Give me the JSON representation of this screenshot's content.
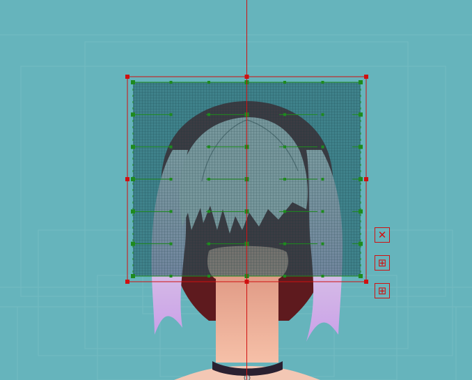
{
  "canvas": {
    "background_color": "#66b4bc",
    "guide_line_color": "#8fc8cf",
    "bounding_box_color": "#d01010",
    "deform_grid_color": "#1e8a1e",
    "grid_fill_color": "#1f5a63"
  },
  "artwork": {
    "hair_color": "#5e1a1e",
    "hair_highlight_color": "#e2e2e2",
    "hair_tip_color": "#d8b4ec",
    "skin_color": "#f0b29a",
    "choker_color": "#2a2030"
  },
  "deformer": {
    "grid_rows": 7,
    "grid_cols": 7
  },
  "toolbar": {
    "buttons": [
      {
        "name": "close-deformer-button",
        "icon": "close-icon",
        "glyph": "✕"
      },
      {
        "name": "grid-edit-button",
        "icon": "grid-edit-icon",
        "glyph": "⊞"
      },
      {
        "name": "grid-toggle-button",
        "icon": "grid-toggle-icon",
        "glyph": "⊞"
      }
    ]
  }
}
